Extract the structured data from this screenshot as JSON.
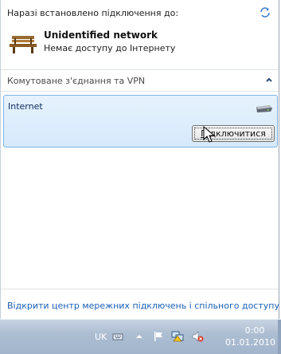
{
  "header": {
    "connected_to": "Наразі встановлено підключення до:"
  },
  "network": {
    "name": "Unidentified network",
    "status": "Немає доступу до Інтернету",
    "icon": "bench-network-icon"
  },
  "section": {
    "title": "Комутоване з'єднання та VPN",
    "expanded": true
  },
  "vpn": {
    "name": "Internet",
    "icon": "modem-icon",
    "connect_label_hotkey": "П",
    "connect_label_rest": "ідключитися"
  },
  "footer": {
    "link": "Відкрити центр мережних підключень і спільного доступу"
  },
  "taskbar": {
    "language": "UK",
    "time": "0:00",
    "date": "01.01.2010",
    "tray_icons": [
      "keyboard-icon",
      "show-hidden-icons-arrow",
      "action-center-flag-icon",
      "network-warning-icon",
      "volume-muted-icon"
    ]
  },
  "colors": {
    "accent": "#1a5fb4",
    "selection_bg": "#dcecfc",
    "selection_border": "#7fb4e6"
  }
}
